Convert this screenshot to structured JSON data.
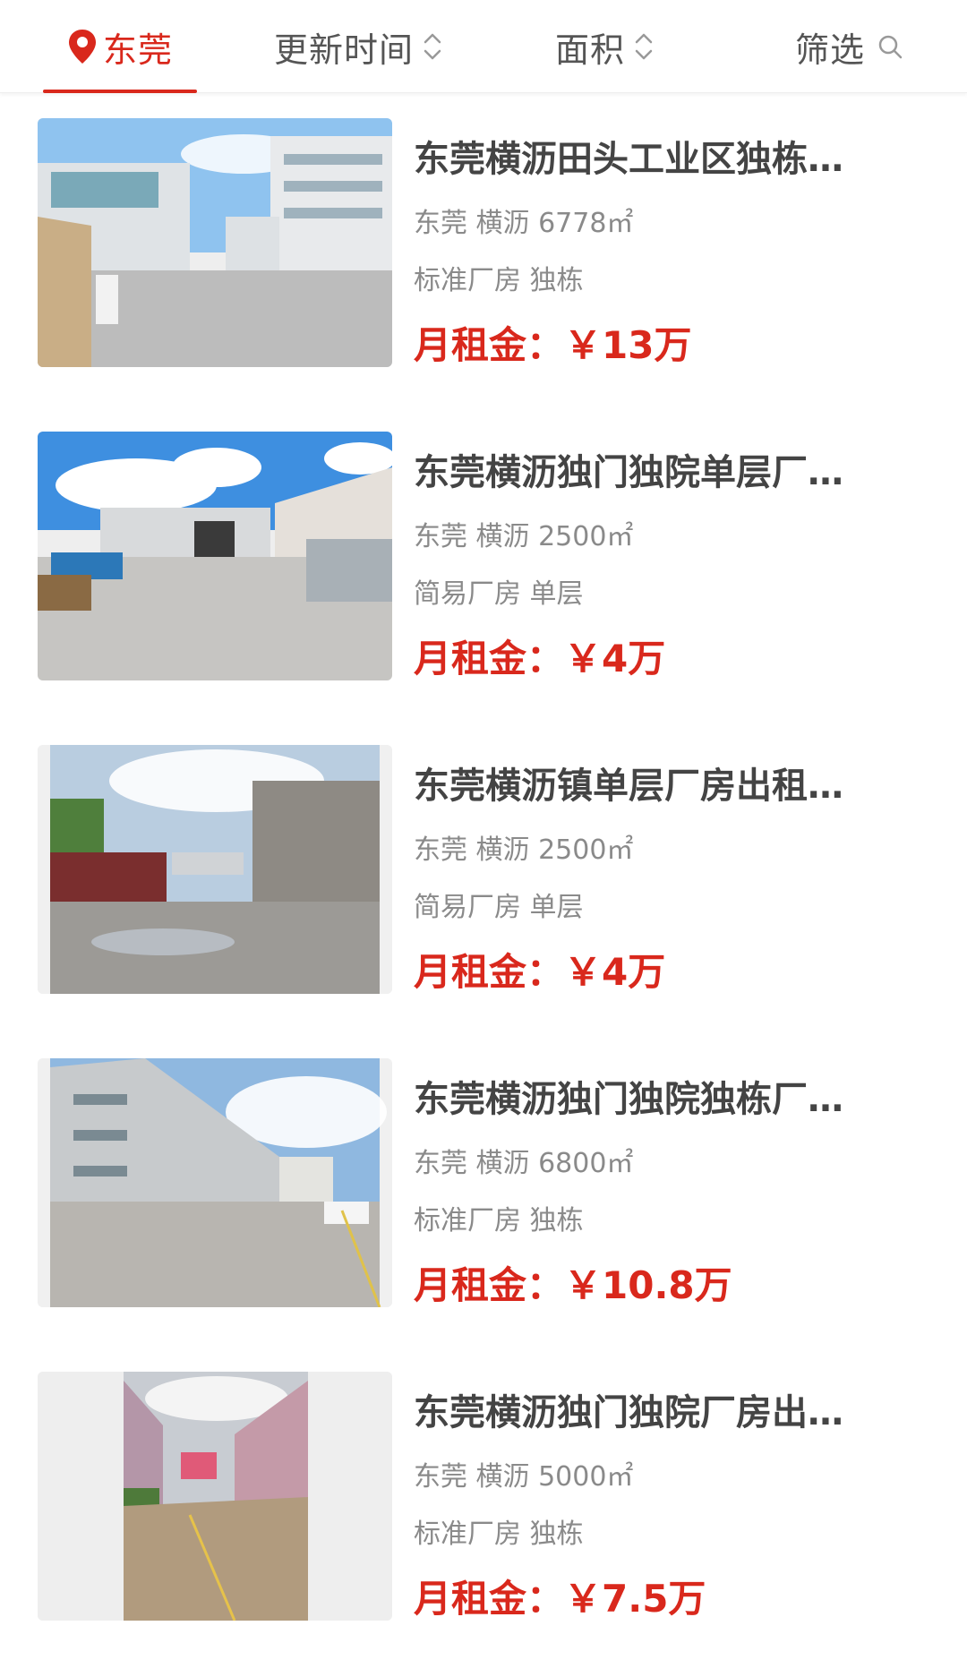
{
  "colors": {
    "accent": "#d9281c",
    "title": "#444444",
    "meta": "#8a8a8a"
  },
  "filter_bar": {
    "location": {
      "label": "东莞",
      "icon": "location-pin-icon"
    },
    "sort_time": {
      "label": "更新时间",
      "icon": "sort-updown-icon"
    },
    "sort_area": {
      "label": "面积",
      "icon": "sort-updown-icon"
    },
    "filter": {
      "label": "筛选",
      "icon": "search-icon"
    }
  },
  "listings": [
    {
      "title": "东莞横沥田头工业区独栋…",
      "location": "东莞 横沥 6778㎡",
      "tags": "标准厂房 独栋",
      "price_label": "月租金：",
      "price": "￥13万"
    },
    {
      "title": "东莞横沥独门独院单层厂…",
      "location": "东莞 横沥 2500㎡",
      "tags": "简易厂房 单层",
      "price_label": "月租金：",
      "price": "￥4万"
    },
    {
      "title": "东莞横沥镇单层厂房出租…",
      "location": "东莞 横沥 2500㎡",
      "tags": "简易厂房 单层",
      "price_label": "月租金：",
      "price": "￥4万"
    },
    {
      "title": "东莞横沥独门独院独栋厂…",
      "location": "东莞 横沥 6800㎡",
      "tags": "标准厂房 独栋",
      "price_label": "月租金：",
      "price": "￥10.8万"
    },
    {
      "title": "东莞横沥独门独院厂房出…",
      "location": "东莞 横沥 5000㎡",
      "tags": "标准厂房 独栋",
      "price_label": "月租金：",
      "price": "￥7.5万"
    }
  ]
}
